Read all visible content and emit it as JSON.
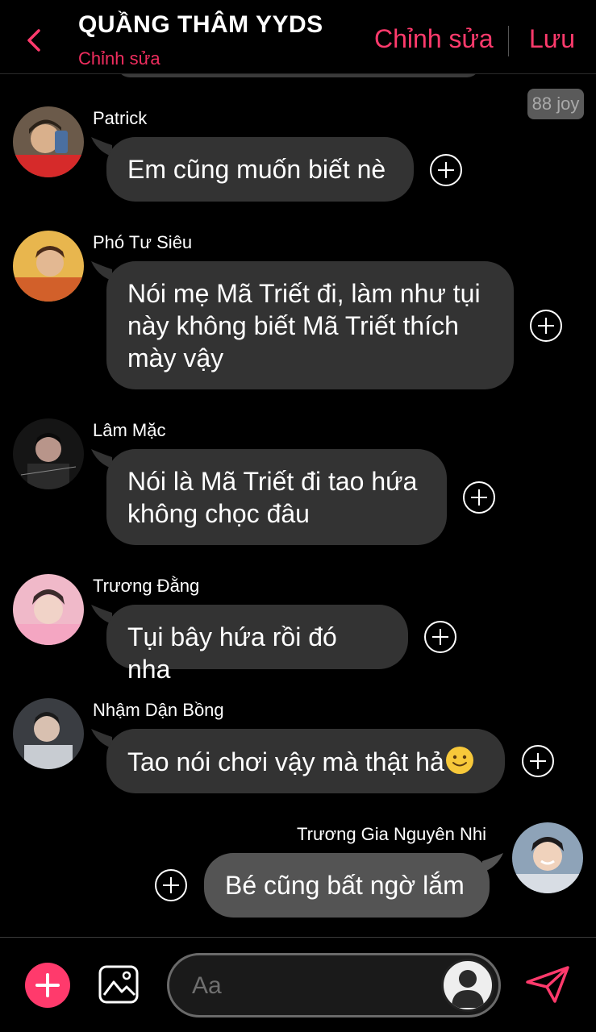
{
  "header": {
    "title": "QUẦNG THÂM YYDS",
    "subtitle": "Chỉnh sửa",
    "edit_label": "Chỉnh sửa",
    "save_label": "Lưu"
  },
  "badge": {
    "text": "88 joy"
  },
  "messages": [
    {
      "sender": "Patrick",
      "text": "Em cũng muốn biết nè"
    },
    {
      "sender": "Phó Tư Siêu",
      "lines": [
        "Nói mẹ Mã Triết đi, làm như tụi",
        "này không biết Mã Triết thích",
        "mày vậy"
      ]
    },
    {
      "sender": "Lâm Mặc",
      "lines": [
        "Nói là Mã Triết đi tao hứa",
        "không chọc đâu"
      ]
    },
    {
      "sender": "Trương Đằng",
      "text": "Tụi bây hứa rồi đó nha"
    },
    {
      "sender": "Nhậm Dận Bồng",
      "text": "Tao nói chơi vậy mà thật hả",
      "emoji": "slightly-smiling-face"
    },
    {
      "sender": "Trương Gia Nguyên Nhi",
      "text": "Bé cũng bất ngờ lắm"
    }
  ],
  "composer": {
    "placeholder": "Aa"
  },
  "colors": {
    "accent": "#ff3a6c",
    "bubble": "#333333",
    "background": "#000000"
  }
}
